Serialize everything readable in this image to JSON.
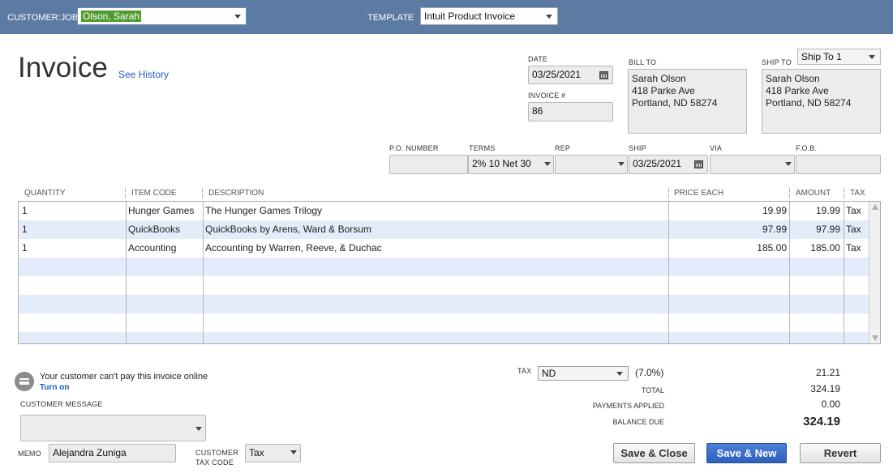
{
  "header": {
    "customer_job_label": "CUSTOMER:JOB",
    "customer_job_value": "Olson, Sarah",
    "template_label": "TEMPLATE",
    "template_value": "Intuit Product Invoice"
  },
  "form": {
    "title": "Invoice",
    "see_history": "See History",
    "date_label": "DATE",
    "date_value": "03/25/2021",
    "invoice_no_label": "INVOICE #",
    "invoice_no_value": "86",
    "bill_to_label": "BILL TO",
    "bill_to": "Sarah Olson\n418 Parke Ave\nPortland, ND 58274",
    "ship_to_label": "SHIP TO",
    "ship_to_select": "Ship To 1",
    "ship_to": "Sarah Olson\n418 Parke Ave\nPortland, ND 58274",
    "po_label": "P.O. NUMBER",
    "po_value": "",
    "terms_label": "TERMS",
    "terms_value": "2% 10 Net 30",
    "rep_label": "REP",
    "rep_value": "",
    "ship_label": "SHIP",
    "ship_value": "03/25/2021",
    "via_label": "VIA",
    "via_value": "",
    "fob_label": "F.O.B.",
    "fob_value": ""
  },
  "table": {
    "columns": [
      "QUANTITY",
      "ITEM CODE",
      "DESCRIPTION",
      "PRICE EACH",
      "AMOUNT",
      "TAX"
    ],
    "rows": [
      {
        "qty": "1",
        "item": "Hunger Games",
        "desc": "The Hunger Games Trilogy",
        "price": "19.99",
        "amount": "19.99",
        "tax": "Tax"
      },
      {
        "qty": "1",
        "item": "QuickBooks",
        "desc": "QuickBooks by Arens, Ward & Borsum",
        "price": "97.99",
        "amount": "97.99",
        "tax": "Tax"
      },
      {
        "qty": "1",
        "item": "Accounting",
        "desc": "Accounting by Warren, Reeve, & Duchac",
        "price": "185.00",
        "amount": "185.00",
        "tax": "Tax"
      }
    ]
  },
  "footer": {
    "online_msg": "Your customer can't pay this invoice online",
    "turn_on": "Turn on",
    "customer_message_label": "CUSTOMER MESSAGE",
    "memo_label": "MEMO",
    "memo_value": "Alejandra Zuniga",
    "customer_tax_code_label_1": "CUSTOMER",
    "customer_tax_code_label_2": "TAX CODE",
    "customer_tax_code_value": "Tax",
    "tax_label": "TAX",
    "tax_code": "ND",
    "tax_rate": "(7.0%)",
    "tax_amount": "21.21",
    "total_label": "TOTAL",
    "total_value": "324.19",
    "payments_label": "PAYMENTS APPLIED",
    "payments_value": "0.00",
    "balance_label": "BALANCE DUE",
    "balance_value": "324.19"
  },
  "buttons": {
    "save_close": "Save & Close",
    "save_new": "Save & New",
    "revert": "Revert"
  },
  "colors": {
    "topbar": "#5b7ba3",
    "row_alt": "#e2ecfa",
    "primary_button": "#2f5fbd"
  }
}
